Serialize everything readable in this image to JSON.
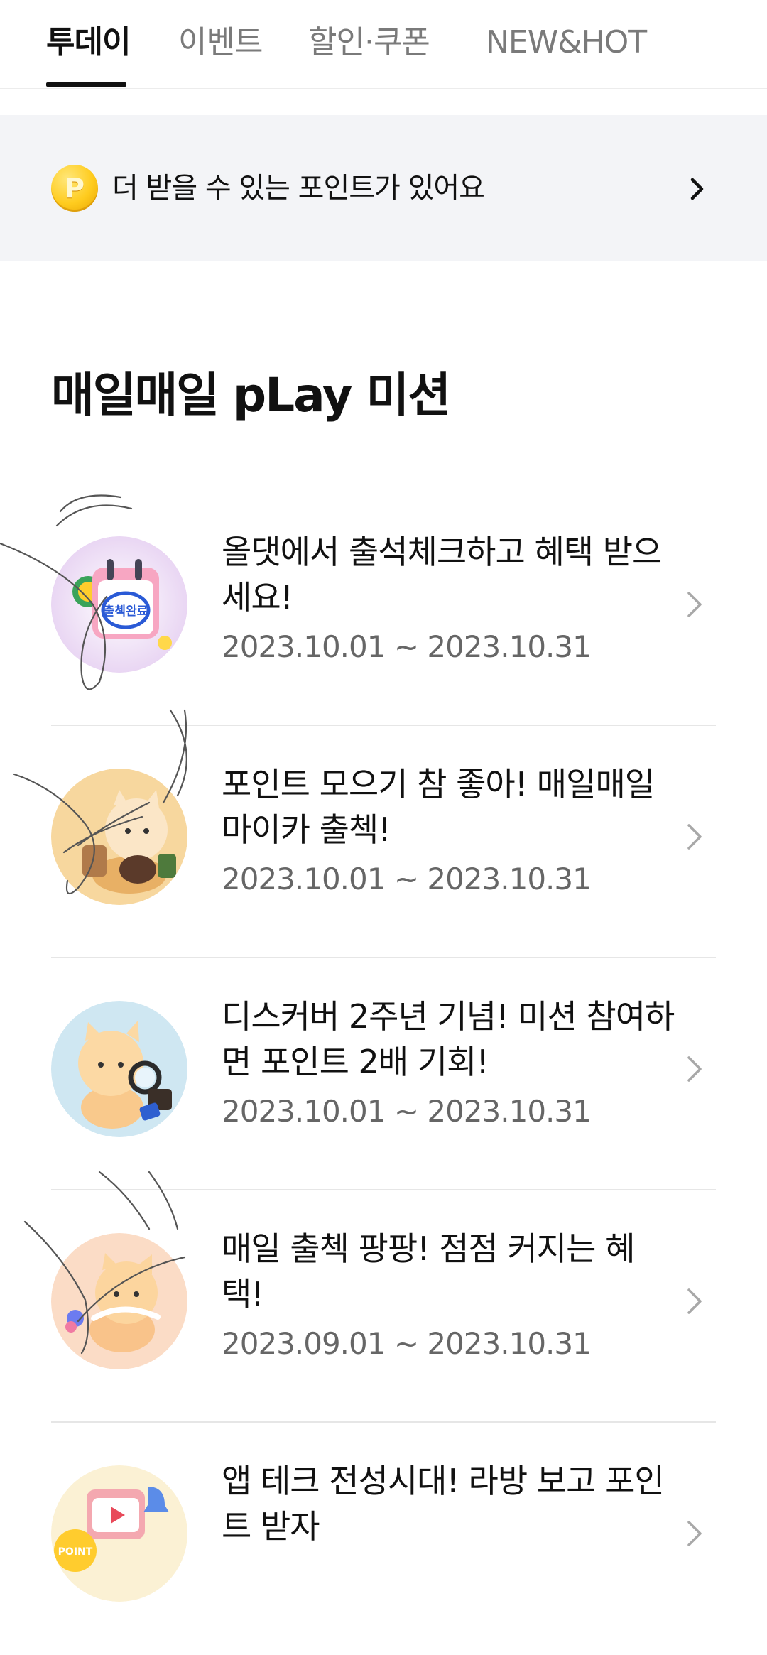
{
  "tabs": [
    {
      "label": "투데이",
      "active": true
    },
    {
      "label": "이벤트",
      "active": false
    },
    {
      "label": "할인·쿠폰",
      "active": false
    },
    {
      "label": "NEW&HOT",
      "active": false
    }
  ],
  "point_banner": {
    "coin_glyph": "P",
    "text": "더 받을 수 있는 포인트가 있어요",
    "icon": "chevron-right-icon"
  },
  "section": {
    "title": "매일매일 pLay 미션"
  },
  "missions": [
    {
      "title": "올댓에서 출석체크하고 혜택 받으세요!",
      "date": "2023.10.01 ~ 2023.10.31",
      "thumb_bg": "#f3e6f7",
      "thumb_badge_text": "출첵완료"
    },
    {
      "title": "포인트 모으기 참 좋아! 매일매일 마이카 출첵!",
      "date": "2023.10.01 ~ 2023.10.31",
      "thumb_bg": "#f7d9a0"
    },
    {
      "title": "디스커버 2주년 기념! 미션 참여하면 포인트 2배 기회!",
      "date": "2023.10.01 ~ 2023.10.31",
      "thumb_bg": "#cfe8f3"
    },
    {
      "title": "매일 출첵 팡팡! 점점 커지는 혜택!",
      "date": "2023.09.01 ~ 2023.10.31",
      "thumb_bg": "#fbe0cc"
    },
    {
      "title": "앱 테크 전성시대! 라방 보고 포인트 받자",
      "date": "",
      "thumb_bg": "#fbf0d0",
      "thumb_badge_text": "POINT"
    }
  ],
  "colors": {
    "accent_text": "#111111",
    "muted_text": "#666666",
    "banner_bg": "#f3f4f7",
    "divider": "#e6e6e6"
  }
}
